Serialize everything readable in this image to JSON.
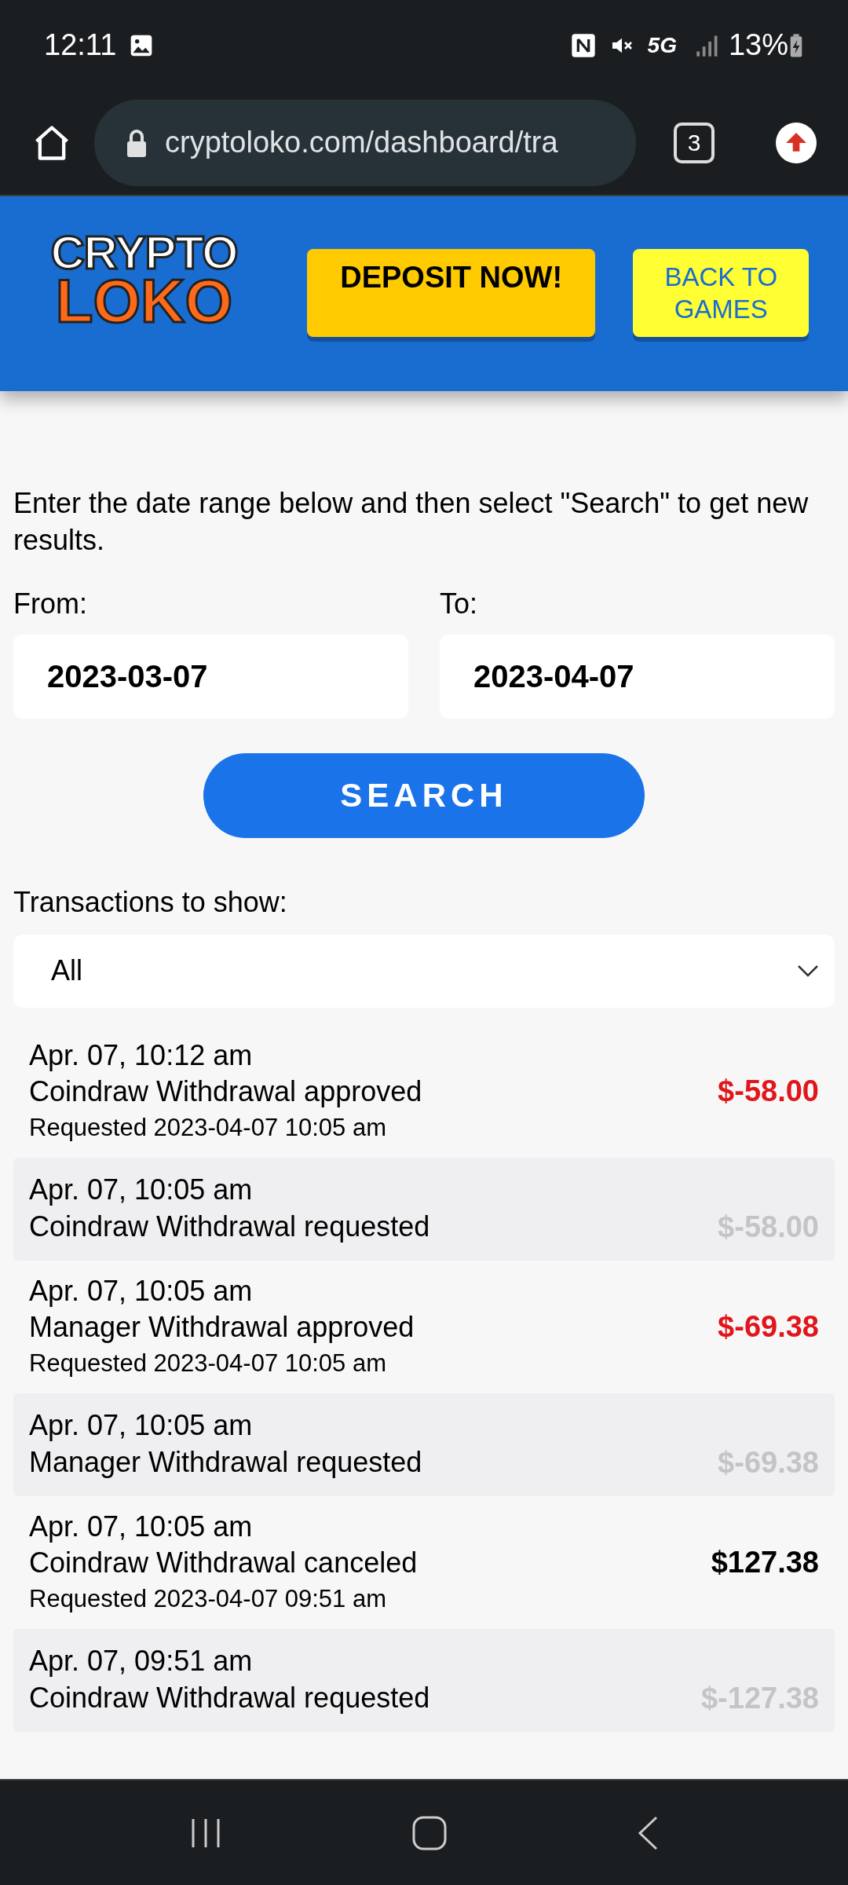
{
  "status_bar": {
    "time": "12:11",
    "battery": "13%",
    "network": "5G"
  },
  "browser": {
    "url": "cryptoloko.com/dashboard/tra",
    "tab_count": "3"
  },
  "header": {
    "logo_top": "CRYPTO",
    "logo_bottom": "LOKO",
    "deposit_button": "DEPOSIT NOW!",
    "back_button": "BACK TO GAMES"
  },
  "page": {
    "intro": "Enter the date range below and then select \"Search\" to get new results.",
    "from_label": "From:",
    "from_value": "2023-03-07",
    "to_label": "To:",
    "to_value": "2023-04-07",
    "search_button": "SEARCH",
    "filter_label": "Transactions to show:",
    "filter_value": "All"
  },
  "transactions": [
    {
      "kind": "approved",
      "date": "Apr. 07, 10:12 am",
      "description": "Coindraw Withdrawal approved",
      "requested": "Requested 2023-04-07 10:05 am",
      "amount": "$-58.00"
    },
    {
      "kind": "requested",
      "date": "Apr. 07, 10:05 am",
      "description": "Coindraw Withdrawal requested",
      "amount": "$-58.00"
    },
    {
      "kind": "approved",
      "date": "Apr. 07, 10:05 am",
      "description": "Manager Withdrawal approved",
      "requested": "Requested 2023-04-07 10:05 am",
      "amount": "$-69.38"
    },
    {
      "kind": "requested",
      "date": "Apr. 07, 10:05 am",
      "description": "Manager Withdrawal requested",
      "amount": "$-69.38"
    },
    {
      "kind": "canceled",
      "date": "Apr. 07, 10:05 am",
      "description": "Coindraw Withdrawal canceled",
      "requested": "Requested 2023-04-07 09:51 am",
      "amount": "$127.38"
    },
    {
      "kind": "requested",
      "date": "Apr. 07, 09:51 am",
      "description": "Coindraw Withdrawal requested",
      "amount": "$-127.38"
    }
  ]
}
